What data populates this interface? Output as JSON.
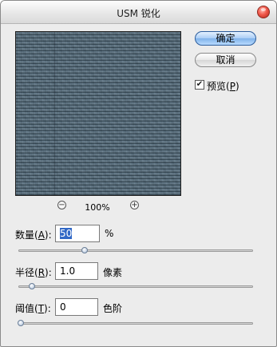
{
  "window": {
    "title": "USM 锐化"
  },
  "preview": {
    "zoom_out": "−",
    "zoom_in": "+",
    "zoom_level": "100%"
  },
  "buttons": {
    "ok": "确定",
    "cancel": "取消"
  },
  "preview_checkbox": {
    "checked": true,
    "mark": "✔",
    "label_pre": "预览(",
    "label_key": "P",
    "label_post": ")"
  },
  "fields": {
    "amount": {
      "label_pre": "数量(",
      "label_key": "A",
      "label_post": "):",
      "value": "50",
      "unit": "%",
      "slider_fraction": 0.28
    },
    "radius": {
      "label_pre": "半径(",
      "label_key": "R",
      "label_post": "):",
      "value": "1.0",
      "unit": "像素",
      "slider_fraction": 0.05
    },
    "threshold": {
      "label_pre": "阈值(",
      "label_key": "T",
      "label_post": "):",
      "value": "0",
      "unit": "色阶",
      "slider_fraction": 0.0
    }
  }
}
